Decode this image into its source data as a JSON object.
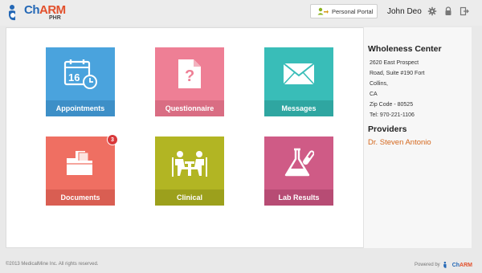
{
  "header": {
    "logo": {
      "part1": "Ch",
      "part2": "ARM",
      "sub": "PHR"
    },
    "portal_button": "Personal Portal",
    "user_name": "John Deo"
  },
  "tiles": [
    {
      "label": "Appointments",
      "color": "#4aa3dd",
      "label_bg": "#3d8fc7",
      "icon": "calendar-icon",
      "date": "16"
    },
    {
      "label": "Questionnaire",
      "color": "#ee7f95",
      "label_bg": "#d96d83",
      "icon": "question-document-icon"
    },
    {
      "label": "Messages",
      "color": "#39bdb8",
      "label_bg": "#2fa6a1",
      "icon": "envelope-icon"
    },
    {
      "label": "Documents",
      "color": "#ef6f62",
      "label_bg": "#d95e52",
      "icon": "folder-documents-icon",
      "badge": "3"
    },
    {
      "label": "Clinical",
      "color": "#b2b523",
      "label_bg": "#9ca01c",
      "icon": "consultation-icon"
    },
    {
      "label": "Lab Results",
      "color": "#cf5b86",
      "label_bg": "#b74c74",
      "icon": "flask-icon"
    }
  ],
  "sidebar": {
    "center_title": "Wholeness Center",
    "address_lines": [
      "2620 East Prospect",
      "Road, Suite #190  Fort",
      "Collins,",
      "CA",
      "Zip Code - 80525",
      "Tel: 970-221-1106"
    ],
    "providers_title": "Providers",
    "provider": "Dr. Steven Antonio"
  },
  "footer": {
    "copyright": "©2013 MedicalMine Inc. All rights reserved.",
    "powered_by": "Powered by",
    "brand1": "Ch",
    "brand2": "ARM"
  }
}
